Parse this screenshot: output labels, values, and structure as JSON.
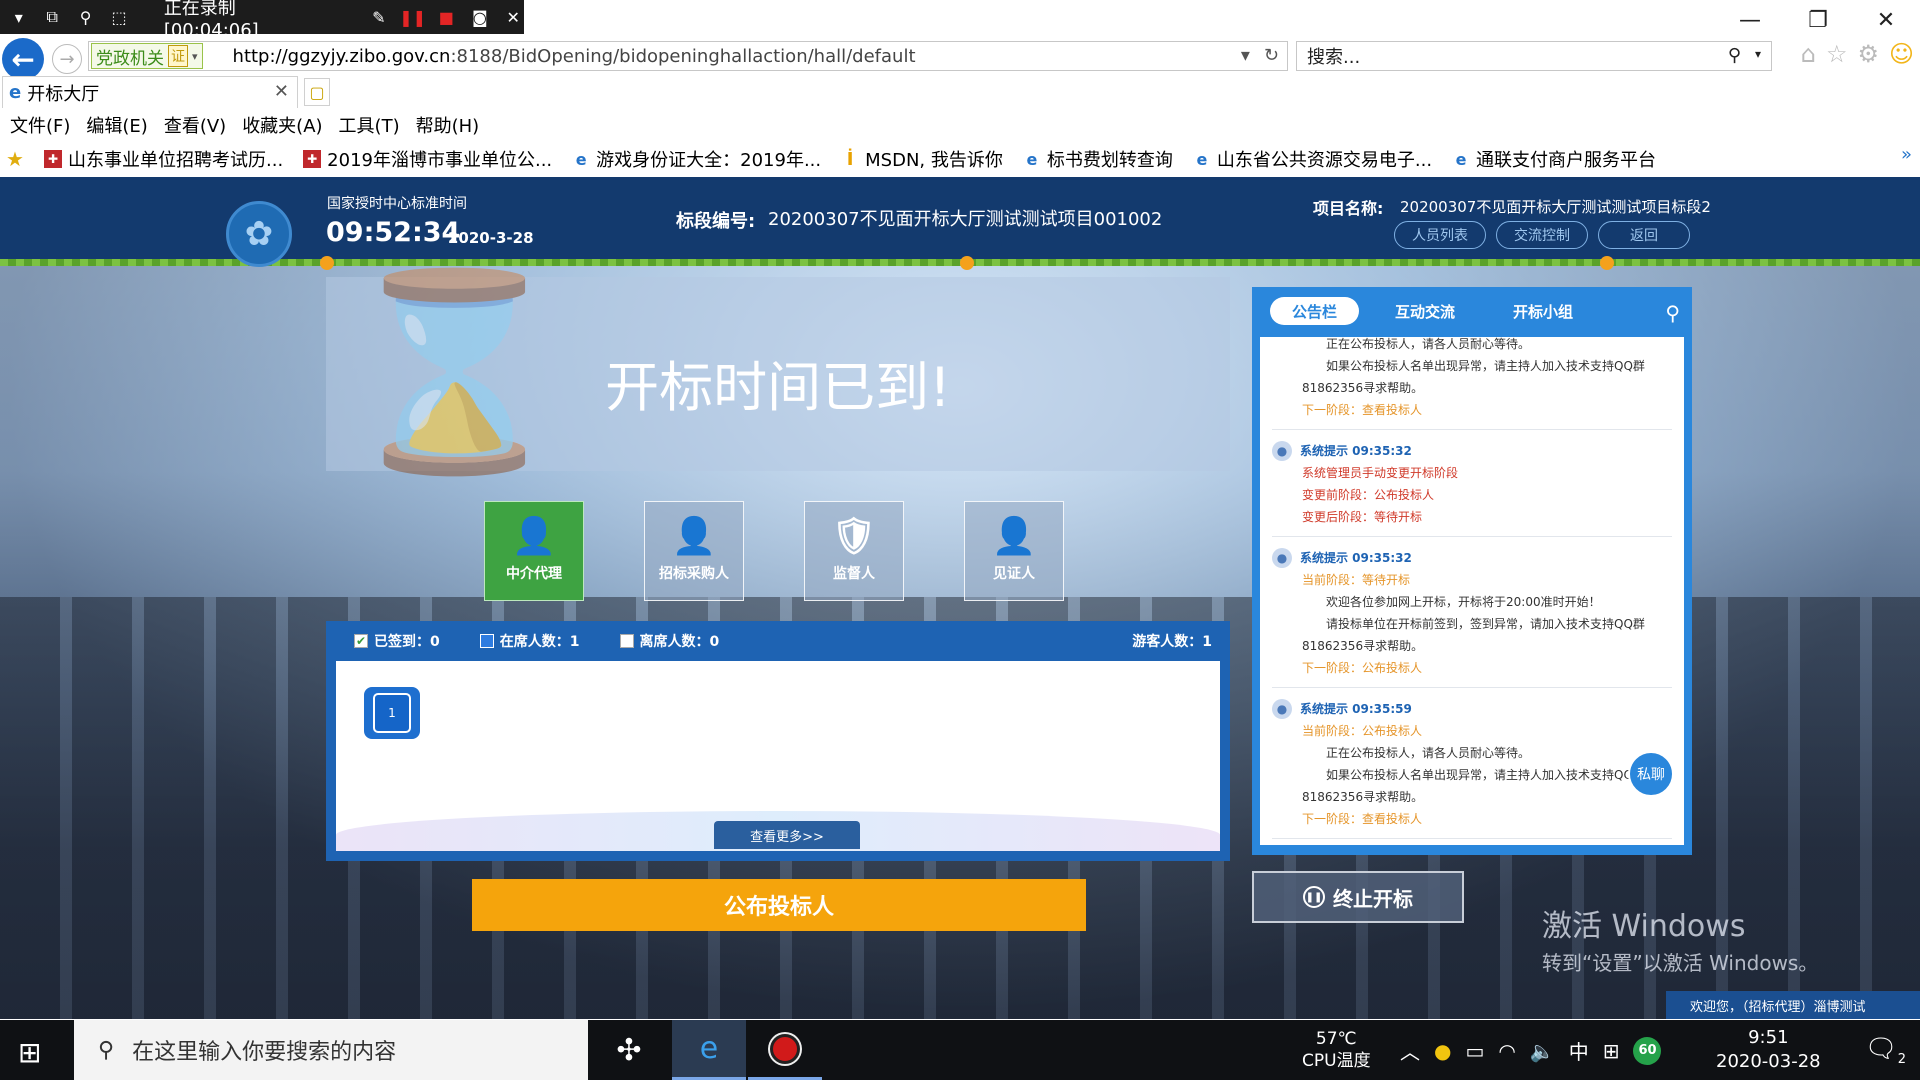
{
  "recorder": {
    "status": "正在录制 [00:04:06]"
  },
  "browser": {
    "gov_badge": "党政机关",
    "gov_badge_mark": "证",
    "url_host": "http://ggzyjy.zibo.gov.cn",
    "url_path": ":8188/BidOpening/bidopeninghallaction/hall/default",
    "search_placeholder": "搜索...",
    "tab_title": "开标大厅",
    "menu": [
      "文件(F)",
      "编辑(E)",
      "查看(V)",
      "收藏夹(A)",
      "工具(T)",
      "帮助(H)"
    ],
    "favorites": [
      {
        "label": "山东事业单位招聘考试历...",
        "icon": "red"
      },
      {
        "label": "2019年淄博市事业单位公...",
        "icon": "red"
      },
      {
        "label": "游戏身份证大全：2019年...",
        "icon": "blue"
      },
      {
        "label": "MSDN, 我告诉你",
        "icon": "msdn"
      },
      {
        "label": "标书费划转查询",
        "icon": "blue"
      },
      {
        "label": "山东省公共资源交易电子...",
        "icon": "blue"
      },
      {
        "label": "通联支付商户服务平台",
        "icon": "blue"
      }
    ]
  },
  "header": {
    "ntc_label": "国家授时中心标准时间",
    "time": "09:52:34",
    "date": "2020-3-28",
    "section_label": "标段编号:",
    "section_value": "20200307不见面开标大厅测试测试项目001002",
    "project_label": "项目名称:",
    "project_value": "20200307不见面开标大厅测试测试项目标段2",
    "buttons": [
      "人员列表",
      "交流控制",
      "返回"
    ]
  },
  "banner": {
    "title": "开标时间已到!"
  },
  "roles": [
    {
      "label": "中介代理",
      "active": true
    },
    {
      "label": "招标采购人",
      "active": false
    },
    {
      "label": "监督人",
      "active": false
    },
    {
      "label": "见证人",
      "active": false
    }
  ],
  "attendance": {
    "signed": "已签到：0",
    "present": "在席人数：1",
    "absent": "离席人数：0",
    "visitors": "游客人数：1",
    "seat_number": "1",
    "more": "查看更多>>"
  },
  "publish_button": "公布投标人",
  "sidebar": {
    "tabs": [
      "公告栏",
      "互动交流",
      "开标小组"
    ],
    "messages": [
      {
        "head": "",
        "lines": [
          {
            "text": "正在公布投标人，请各人员耐心等待。",
            "style": "indent"
          },
          {
            "text": "如果公布投标人名单出现异常，请主持人加入技术支持QQ群",
            "style": "indent"
          },
          {
            "text": "81862356寻求帮助。",
            "style": "noind"
          },
          {
            "text": "下一阶段：查看投标人",
            "style": "orange"
          }
        ]
      },
      {
        "head": "系统提示 09:35:32",
        "lines": [
          {
            "text": "系统管理员手动变更开标阶段",
            "style": "red"
          },
          {
            "text": "变更前阶段：公布投标人",
            "style": "red"
          },
          {
            "text": "变更后阶段：等待开标",
            "style": "red"
          }
        ]
      },
      {
        "head": "系统提示 09:35:32",
        "lines": [
          {
            "text": "当前阶段：等待开标",
            "style": "orange"
          },
          {
            "text": "欢迎各位参加网上开标，开标将于20:00准时开始！",
            "style": "indent"
          },
          {
            "text": "请投标单位在开标前签到，签到异常，请加入技术支持QQ群",
            "style": "indent"
          },
          {
            "text": "81862356寻求帮助。",
            "style": "noind"
          },
          {
            "text": "下一阶段：公布投标人",
            "style": "orange"
          }
        ]
      },
      {
        "head": "系统提示 09:35:59",
        "lines": [
          {
            "text": "当前阶段：公布投标人",
            "style": "orange"
          },
          {
            "text": "正在公布投标人，请各人员耐心等待。",
            "style": "indent"
          },
          {
            "text": "如果公布投标人名单出现异常，请主持人加入技术支持QQ群",
            "style": "indent"
          },
          {
            "text": "81862356寻求帮助。",
            "style": "noind"
          },
          {
            "text": "下一阶段：查看投标人",
            "style": "orange"
          }
        ]
      }
    ],
    "private_chat": "私聊"
  },
  "stop_button": "终止开标",
  "activate": {
    "line1": "激活 Windows",
    "line2": "转到“设置”以激活 Windows。"
  },
  "welcome": "欢迎您，（招标代理）淄博测试",
  "taskbar": {
    "search_placeholder": "在这里输入你要搜索的内容",
    "temp": "57℃",
    "temp_label": "CPU温度",
    "ime": "中",
    "badge": "60",
    "time": "9:51",
    "date": "2020-03-28",
    "notif_count": "2"
  }
}
